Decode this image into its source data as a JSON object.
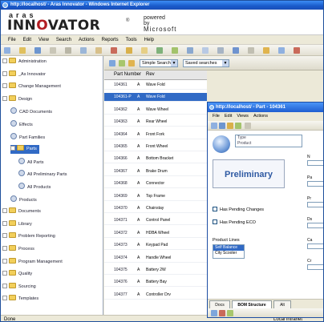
{
  "window": {
    "title": "http://localhost/ - Aras Innovator - Windows Internet Explorer"
  },
  "banner": {
    "logo_top": "aras",
    "logo_main_pre": "INN",
    "logo_main_o": "O",
    "logo_main_post": "VATOR",
    "logo_reg": "®",
    "powered_line1": "powered",
    "powered_line2": "by",
    "powered_line3": "Microsoft"
  },
  "menu": [
    "File",
    "Edit",
    "View",
    "Search",
    "Actions",
    "Reports",
    "Tools",
    "Help"
  ],
  "tree": [
    {
      "label": "Administration",
      "type": "folder",
      "expand": "+",
      "indent": 0
    },
    {
      "label": "_As Innovator",
      "type": "folder",
      "expand": "+",
      "indent": 0
    },
    {
      "label": "Change Management",
      "type": "folder",
      "expand": "+",
      "indent": 0
    },
    {
      "label": "Design",
      "type": "folder",
      "expand": "-",
      "indent": 0
    },
    {
      "label": "CAD Documents",
      "type": "gear",
      "expand": "",
      "indent": 1
    },
    {
      "label": "Effects",
      "type": "gear",
      "expand": "",
      "indent": 1
    },
    {
      "label": "Part Families",
      "type": "gear",
      "expand": "",
      "indent": 1
    },
    {
      "label": "Parts",
      "type": "folder",
      "expand": "-",
      "indent": 1,
      "selected": true
    },
    {
      "label": "All Parts",
      "type": "gear",
      "expand": "",
      "indent": 2
    },
    {
      "label": "All Preliminary Parts",
      "type": "gear",
      "expand": "",
      "indent": 2
    },
    {
      "label": "All Products",
      "type": "gear",
      "expand": "",
      "indent": 2
    },
    {
      "label": "Products",
      "type": "gear",
      "expand": "",
      "indent": 1
    },
    {
      "label": "Documents",
      "type": "folder",
      "expand": "+",
      "indent": 0
    },
    {
      "label": "Library",
      "type": "folder",
      "expand": "+",
      "indent": 0
    },
    {
      "label": "Problem Reporting",
      "type": "folder",
      "expand": "+",
      "indent": 0
    },
    {
      "label": "Process",
      "type": "folder",
      "expand": "+",
      "indent": 0
    },
    {
      "label": "Program Management",
      "type": "folder",
      "expand": "+",
      "indent": 0
    },
    {
      "label": "Quality",
      "type": "folder",
      "expand": "+",
      "indent": 0
    },
    {
      "label": "Sourcing",
      "type": "folder",
      "expand": "+",
      "indent": 0
    },
    {
      "label": "Templates",
      "type": "folder",
      "expand": "+",
      "indent": 0
    }
  ],
  "grid_toolbar": {
    "search_mode": "Simple Search",
    "saved_searches": "Saved searches"
  },
  "grid": {
    "headers": [
      "Part Number",
      "Rev"
    ],
    "rows": [
      {
        "num": "104361",
        "rev": "A",
        "name": "Wave Fold"
      },
      {
        "num": "104361-P",
        "rev": "A",
        "name": "Wave Fold",
        "selected": true
      },
      {
        "num": "104362",
        "rev": "A",
        "name": "Wave Wheel"
      },
      {
        "num": "104363",
        "rev": "A",
        "name": "Rear Wheel"
      },
      {
        "num": "104364",
        "rev": "A",
        "name": "Front Fork"
      },
      {
        "num": "104365",
        "rev": "A",
        "name": "Front Wheel"
      },
      {
        "num": "104366",
        "rev": "A",
        "name": "Bottom Bracket"
      },
      {
        "num": "104367",
        "rev": "A",
        "name": "Brake Drum"
      },
      {
        "num": "104368",
        "rev": "A",
        "name": "Connector"
      },
      {
        "num": "104369",
        "rev": "A",
        "name": "Top Frame"
      },
      {
        "num": "104370",
        "rev": "A",
        "name": "Chainstay"
      },
      {
        "num": "104371",
        "rev": "A",
        "name": "Control Panel"
      },
      {
        "num": "104372",
        "rev": "A",
        "name": "HDBA Wheel"
      },
      {
        "num": "104373",
        "rev": "A",
        "name": "Keypad Pad"
      },
      {
        "num": "104374",
        "rev": "A",
        "name": "Handle Wheel"
      },
      {
        "num": "104375",
        "rev": "A",
        "name": "Battery 2W"
      },
      {
        "num": "104376",
        "rev": "A",
        "name": "Battery Bay"
      },
      {
        "num": "104377",
        "rev": "A",
        "name": "Controller Drv"
      }
    ]
  },
  "popup": {
    "title": "http://localhost/ - Part - 104361",
    "menu": [
      "File",
      "Edit",
      "Views",
      "Actions"
    ],
    "type_label": "Type",
    "type_value": "Product",
    "status": "Preliminary",
    "checkbox1": "Has Pending Changes",
    "checkbox2": "Has Pending ECO",
    "product_lines_label": "Product Lines",
    "product_lines": [
      {
        "label": "Self Balance",
        "selected": true
      },
      {
        "label": "City Scooter",
        "selected": false
      }
    ],
    "side_labels": [
      "N",
      "Pa",
      "Pr",
      "Ds",
      "Ca",
      "Cr"
    ],
    "tabs": [
      "Docs",
      "BOM Structure",
      "Alt"
    ]
  },
  "status": {
    "left": "Done",
    "right": "Local intranet"
  },
  "colors": {
    "titlebar": "#1959c9",
    "selection": "#316ac5",
    "brand_red": "#b21e23"
  }
}
